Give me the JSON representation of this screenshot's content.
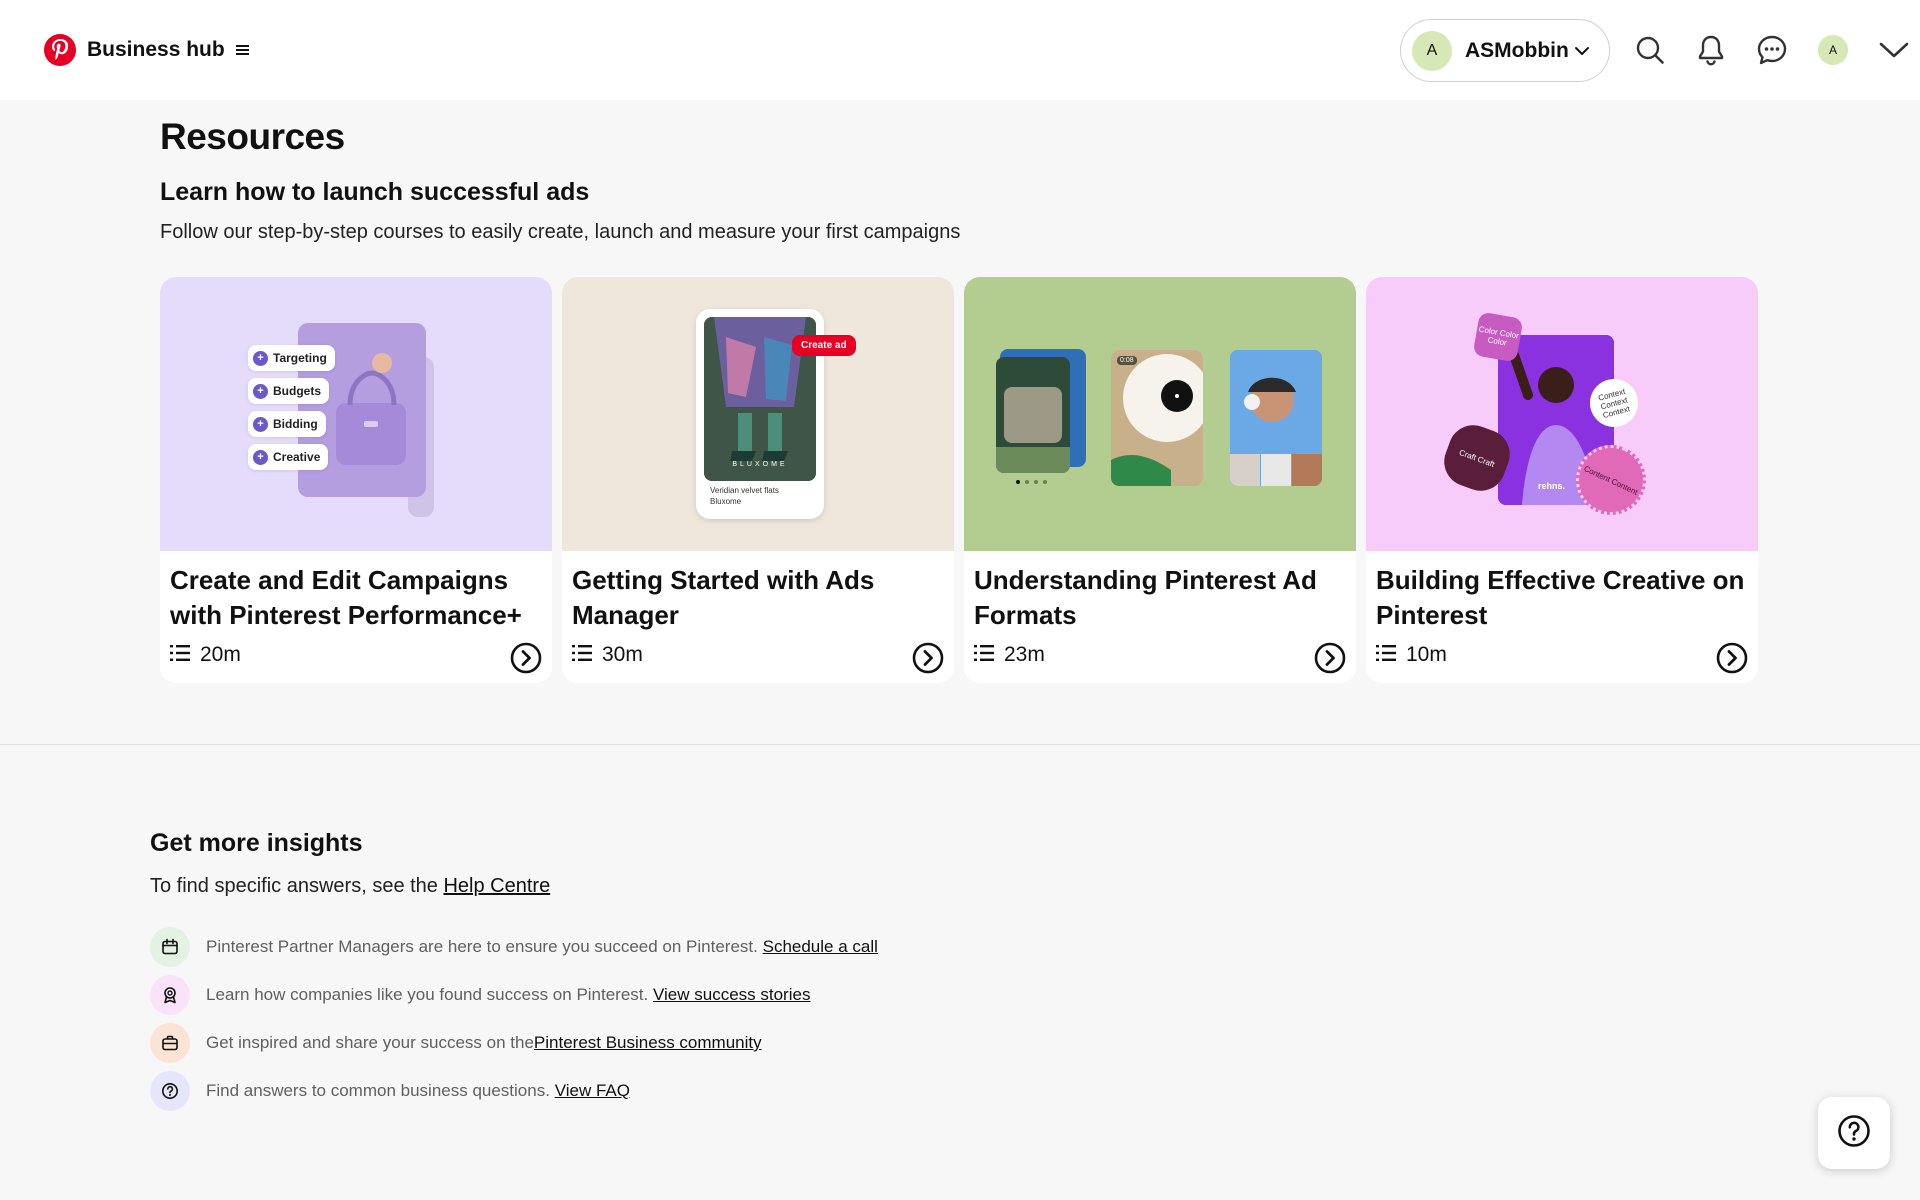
{
  "header": {
    "title": "Business hub",
    "account": {
      "initial": "A",
      "name": "ASMobbin"
    },
    "small_avatar_initial": "A",
    "brand_color": "#e60023"
  },
  "resources": {
    "heading": "Resources",
    "subheading": "Learn how to launch successful ads",
    "description": "Follow our step-by-step courses to easily create, launch and measure your first campaigns",
    "cards": [
      {
        "title": "Create and Edit Campaigns with Pinterest Performance+",
        "duration": "20m",
        "chips": [
          "Targeting",
          "Budgets",
          "Bidding",
          "Creative"
        ],
        "thumb_color": "#e5dcfb"
      },
      {
        "title": "Getting Started with Ads Manager",
        "duration": "30m",
        "create_ad_label": "Create ad",
        "brand_mark": "BLUXOME",
        "caption_line1": "Veridian velvet flats",
        "caption_line2": "Bluxome",
        "thumb_color": "#efe6dc"
      },
      {
        "title": "Understanding Pinterest Ad Formats",
        "duration": "23m",
        "video_time": "0:08",
        "thumb_color": "#b3cc8f"
      },
      {
        "title": "Building Effective Creative on Pinterest",
        "duration": "10m",
        "sticker_color": "Color Color Color",
        "sticker_context": "Context Context Context",
        "sticker_craft": "Craft Craft",
        "sticker_content": "Content Content",
        "brand_mark": "rehns.",
        "thumb_color": "#f7ccfb"
      }
    ]
  },
  "insights": {
    "heading": "Get more insights",
    "sub_prefix": "To find specific answers, see the ",
    "sub_link": "Help Centre",
    "rows": [
      {
        "text": "Pinterest Partner Managers are here to ensure you succeed on Pinterest. ",
        "link": "Schedule a call",
        "icon": "calendar-icon",
        "bg": "#e3f2e3"
      },
      {
        "text": "Learn how companies like you found success on Pinterest. ",
        "link": "View success stories",
        "icon": "award-icon",
        "bg": "#f9e3f9"
      },
      {
        "text": "Get inspired and share your success on the ",
        "link": "Pinterest Business community",
        "icon": "briefcase-icon",
        "bg": "#fbe4d6"
      },
      {
        "text": "Find answers to common business questions. ",
        "link": "View FAQ",
        "icon": "question-icon",
        "bg": "#e6e6fb"
      }
    ]
  }
}
